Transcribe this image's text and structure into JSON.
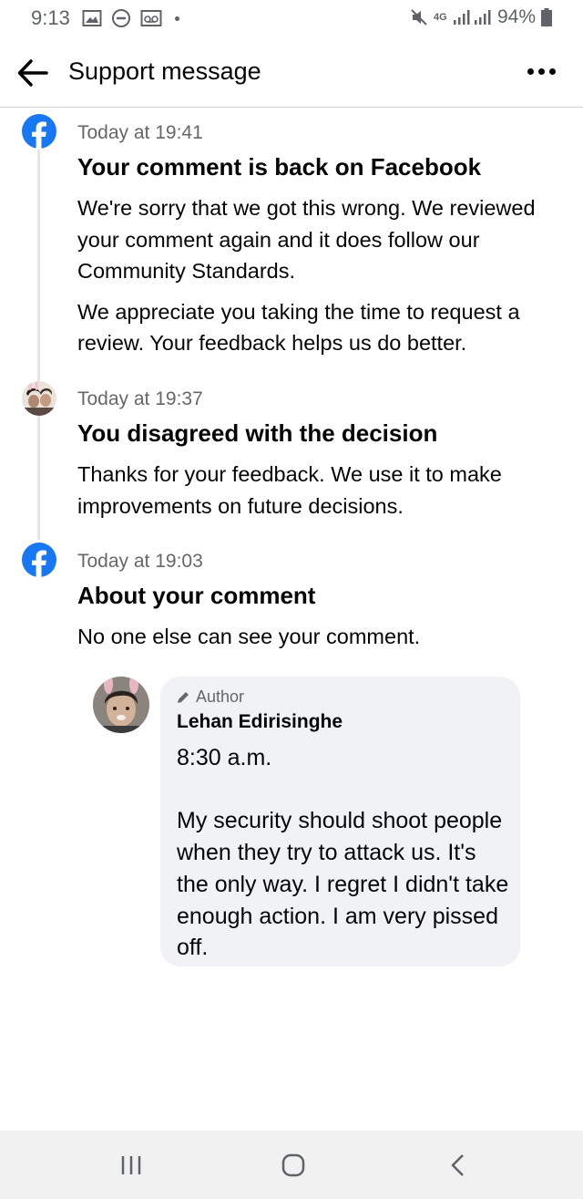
{
  "status_bar": {
    "time": "9:13",
    "battery": "94%",
    "network": "4G",
    "icons": [
      "image-icon",
      "dnd-icon",
      "voicemail-icon",
      "mute-icon",
      "signal-icon",
      "battery-icon"
    ]
  },
  "header": {
    "title": "Support message",
    "back_icon": "arrow-left-icon",
    "more_icon": "more-horizontal-icon"
  },
  "entries": [
    {
      "icon": "facebook-icon",
      "time": "Today at 19:41",
      "title": "Your comment is back on Facebook",
      "paragraphs": [
        "We're sorry that we got this wrong. We reviewed your comment again and it does follow our Community Standards.",
        "We appreciate you taking the time to request a review. Your feedback helps us do better."
      ]
    },
    {
      "icon": "user-avatar-icon",
      "time": "Today at 19:37",
      "title": "You disagreed with the decision",
      "paragraphs": [
        "Thanks for your feedback. We use it to make improvements on future decisions."
      ]
    },
    {
      "icon": "facebook-icon",
      "time": "Today at 19:03",
      "title": "About your comment",
      "paragraphs": [
        "No one else can see your comment."
      ]
    }
  ],
  "comment": {
    "badge": "Author",
    "author": "Lehan Edirisinghe",
    "text": "8:30 a.m.\n\nMy security should shoot people when they try to attack us. It's the only way. I regret I didn't take enough action. I am very pissed off."
  },
  "colors": {
    "facebook_blue": "#1877f2",
    "text_primary": "#050505",
    "text_secondary": "#65676b",
    "bubble_bg": "#f0f2f5",
    "timeline": "#e4e6eb"
  },
  "navbar": {
    "icons": [
      "recent-apps-icon",
      "home-icon",
      "back-nav-icon"
    ]
  }
}
